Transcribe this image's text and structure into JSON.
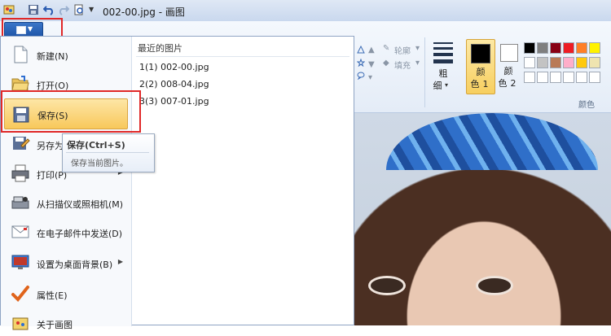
{
  "window": {
    "title": "002-00.jpg - 画图"
  },
  "file_button": {
    "label": ""
  },
  "file_menu": {
    "items": [
      {
        "label": "新建(N)",
        "icon": "new-file-icon",
        "submenu": false
      },
      {
        "label": "打开(O)",
        "icon": "open-folder-icon",
        "submenu": false
      },
      {
        "label": "保存(S)",
        "icon": "save-icon",
        "submenu": false,
        "selected": true
      },
      {
        "label": "另存为",
        "icon": "save-as-icon",
        "submenu": true
      },
      {
        "label": "打印(P)",
        "icon": "printer-icon",
        "submenu": true
      },
      {
        "label": "从扫描仪或照相机(M)",
        "icon": "scanner-icon",
        "submenu": false
      },
      {
        "label": "在电子邮件中发送(D)",
        "icon": "email-icon",
        "submenu": false
      },
      {
        "label": "设置为桌面背景(B)",
        "icon": "desktop-icon",
        "submenu": true
      },
      {
        "label": "属性(E)",
        "icon": "checkmark-icon",
        "submenu": false
      },
      {
        "label": "关于画图",
        "icon": "about-icon",
        "submenu": false
      }
    ],
    "recent": {
      "title": "最近的图片",
      "files": [
        {
          "num": "1",
          "label": "1(1)  002-00.jpg"
        },
        {
          "num": "2",
          "label": "2(2)  008-04.jpg"
        },
        {
          "num": "3",
          "label": "3(3)  007-01.jpg"
        }
      ]
    }
  },
  "tooltip": {
    "title": "保存(Ctrl+S)",
    "description": "保存当前图片。"
  },
  "ribbon": {
    "outline_label": "轮廓",
    "fill_label": "填充",
    "thickness_label": [
      "粗",
      "细"
    ],
    "color1_label": [
      "颜",
      "色",
      "1"
    ],
    "color2_label": [
      "颜",
      "色",
      "2"
    ],
    "colors_group_label": "颜色",
    "palette": [
      "#000000",
      "#7f7f7f",
      "#880015",
      "#ed1c24",
      "#ff7f27",
      "#fff200",
      "#ffffff",
      "#c3c3c3",
      "#b97a57",
      "#ffaec9",
      "#ffc90e",
      "#efe4b0",
      "#ffffff",
      "#ffffff",
      "#ffffff",
      "#ffffff",
      "#ffffff",
      "#ffffff"
    ]
  },
  "highlight_color": "#e02828"
}
